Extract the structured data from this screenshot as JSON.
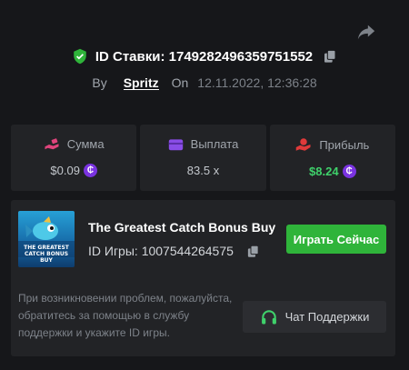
{
  "bet": {
    "id_label": "ID Ставки:",
    "id_value": "1749282496359751552",
    "by_label": "By",
    "username": "Spritz",
    "on_label": "On",
    "date": "12.11.2022, 12:36:28"
  },
  "stats": [
    {
      "label": "Сумма",
      "value": "$0.09",
      "coin": true,
      "icon": "money-hand-icon"
    },
    {
      "label": "Выплата",
      "value": "83.5 x",
      "coin": false,
      "icon": "wallet-icon"
    },
    {
      "label": "Прибыль",
      "value": "$8.24",
      "coin": true,
      "icon": "profit-hand-icon"
    }
  ],
  "coin_symbol": "₵",
  "game": {
    "title": "The Greatest Catch Bonus Buy",
    "thumb_text": "THE GREATEST CATCH BONUS BUY",
    "id_label": "ID Игры:",
    "id_value": "1007544264575",
    "play_label": "Играть Сейчас"
  },
  "support": {
    "help_text": "При возникновении проблем, пожалуйста, обратитесь за помощью в службу поддержки и укажите ID игры.",
    "button_label": "Чат Поддержки"
  },
  "colors": {
    "background": "#16171a",
    "panel": "#222326",
    "accent_green": "#2fb43a",
    "profit_green": "#3fd16b",
    "coin_purple": "#7a33e0",
    "pink_icon": "#e0447c",
    "purple_icon": "#8a4de8",
    "red_icon": "#e03a3a"
  }
}
